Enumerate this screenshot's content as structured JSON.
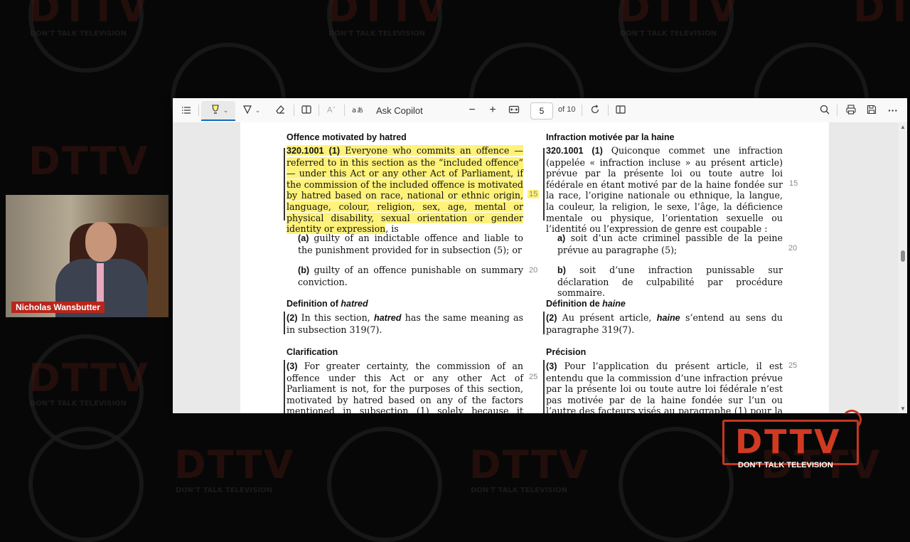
{
  "background": {
    "watermark_text": "DTTV",
    "watermark_sub": "DON'T TALK TELEVISION",
    "color": "#070707"
  },
  "pdf_viewer": {
    "toolbar": {
      "contents_icon": "list-icon",
      "highlight_icon": "highlighter-icon",
      "draw_icon": "pen-icon",
      "erase_icon": "eraser-icon",
      "text_icon": "text-box-icon",
      "read_aloud_icon": "read-aloud-icon",
      "translate_icon": "translate-icon",
      "ask_copilot": "Ask Copilot",
      "zoom_out": "−",
      "zoom_in": "+",
      "fit_icon": "fit-width-icon",
      "page_current": "5",
      "page_total": "of 10",
      "rotate_icon": "rotate-icon",
      "page_view_icon": "page-view-icon",
      "search_icon": "search-icon",
      "print_icon": "print-icon",
      "save_icon": "save-icon",
      "more": "···"
    },
    "accent_color": "#0f6cbd",
    "highlight_color": "#fff27a"
  },
  "document": {
    "en": {
      "heading1": "Offence motivated by hatred",
      "sec_num": "320.1001",
      "sub1": "(1)",
      "p1_highlighted": "Everyone who commits an offence — referred to in this section as the “included offence” — under this Act or any other Act of Parliament, if the commission of the included offence is motivated by hatred based on race, national or ethnic origin, language, colour, religion, sex, age, mental or physical disability, sexual orientation or gender identity or expression",
      "p1_tail": ", is",
      "a_label": "(a)",
      "a_text": "guilty of an indictable offence and liable to the punishment provided for in subsection (5); or",
      "b_label": "(b)",
      "b_text": "guilty of an offence punishable on summary conviction.",
      "heading2_pre": "Definition of ",
      "heading2_term": "hatred",
      "sub2": "(2)",
      "p2_pre": "In this section,",
      "p2_term": "hatred",
      "p2_post": "has the same meaning as in subsection 319(7).",
      "heading3": "Clarification",
      "sub3": "(3)",
      "p3": "For greater certainty, the commission of an offence under this Act or any other Act of Parliament is not, for the purposes of this section, motivated by hatred based on any of the factors mentioned in subsection (1) solely because it discredits, humiliates, hurts or offends."
    },
    "fr": {
      "heading1": "Infraction motivée par la haine",
      "sec_num": "320.1001",
      "sub1": "(1)",
      "p1": "Quiconque commet une infraction (appelée « infraction incluse » au présent article) prévue par la présente loi ou toute autre loi fédérale en étant motivé par de la haine fondée sur la race, l’origine nationale ou ethnique, la langue, la couleur, la religion, le sexe, l’âge, la déficience mentale ou physique, l’orientation sexuelle ou l’identité ou l’expression de genre est coupable :",
      "a_label": "a)",
      "a_text": "soit d’un acte criminel passible de la peine prévue au paragraphe (5);",
      "b_label": "b)",
      "b_text": "soit d’une infraction punissable sur déclaration de culpabilité par procédure sommaire.",
      "heading2_pre": "Définition de ",
      "heading2_term": "haine",
      "sub2": "(2)",
      "p2_pre": "Au présent article,",
      "p2_term": "haine",
      "p2_post": "s’entend au sens du paragraphe 319(7).",
      "heading3": "Précision",
      "sub3": "(3)",
      "p3": "Pour l’application du présent article, il est entendu que la commission d’une infraction prévue par la présente loi ou toute autre loi fédérale n’est pas motivée par de la haine fondée sur l’un ou l’autre des facteurs visés au paragraphe (1) pour la seule raison qu’elle discrédite, hu-"
    },
    "line_numbers": {
      "en_15": "15",
      "en_20": "20",
      "en_25": "25",
      "fr_15": "15",
      "fr_20": "20",
      "fr_25": "25"
    }
  },
  "webcam": {
    "name": "Nicholas Wansbutter",
    "tag_color": "#b8261b"
  },
  "logo": {
    "text": "DTTV",
    "sub": "DON'T TALK TELEVISION",
    "color": "#d03a22"
  }
}
